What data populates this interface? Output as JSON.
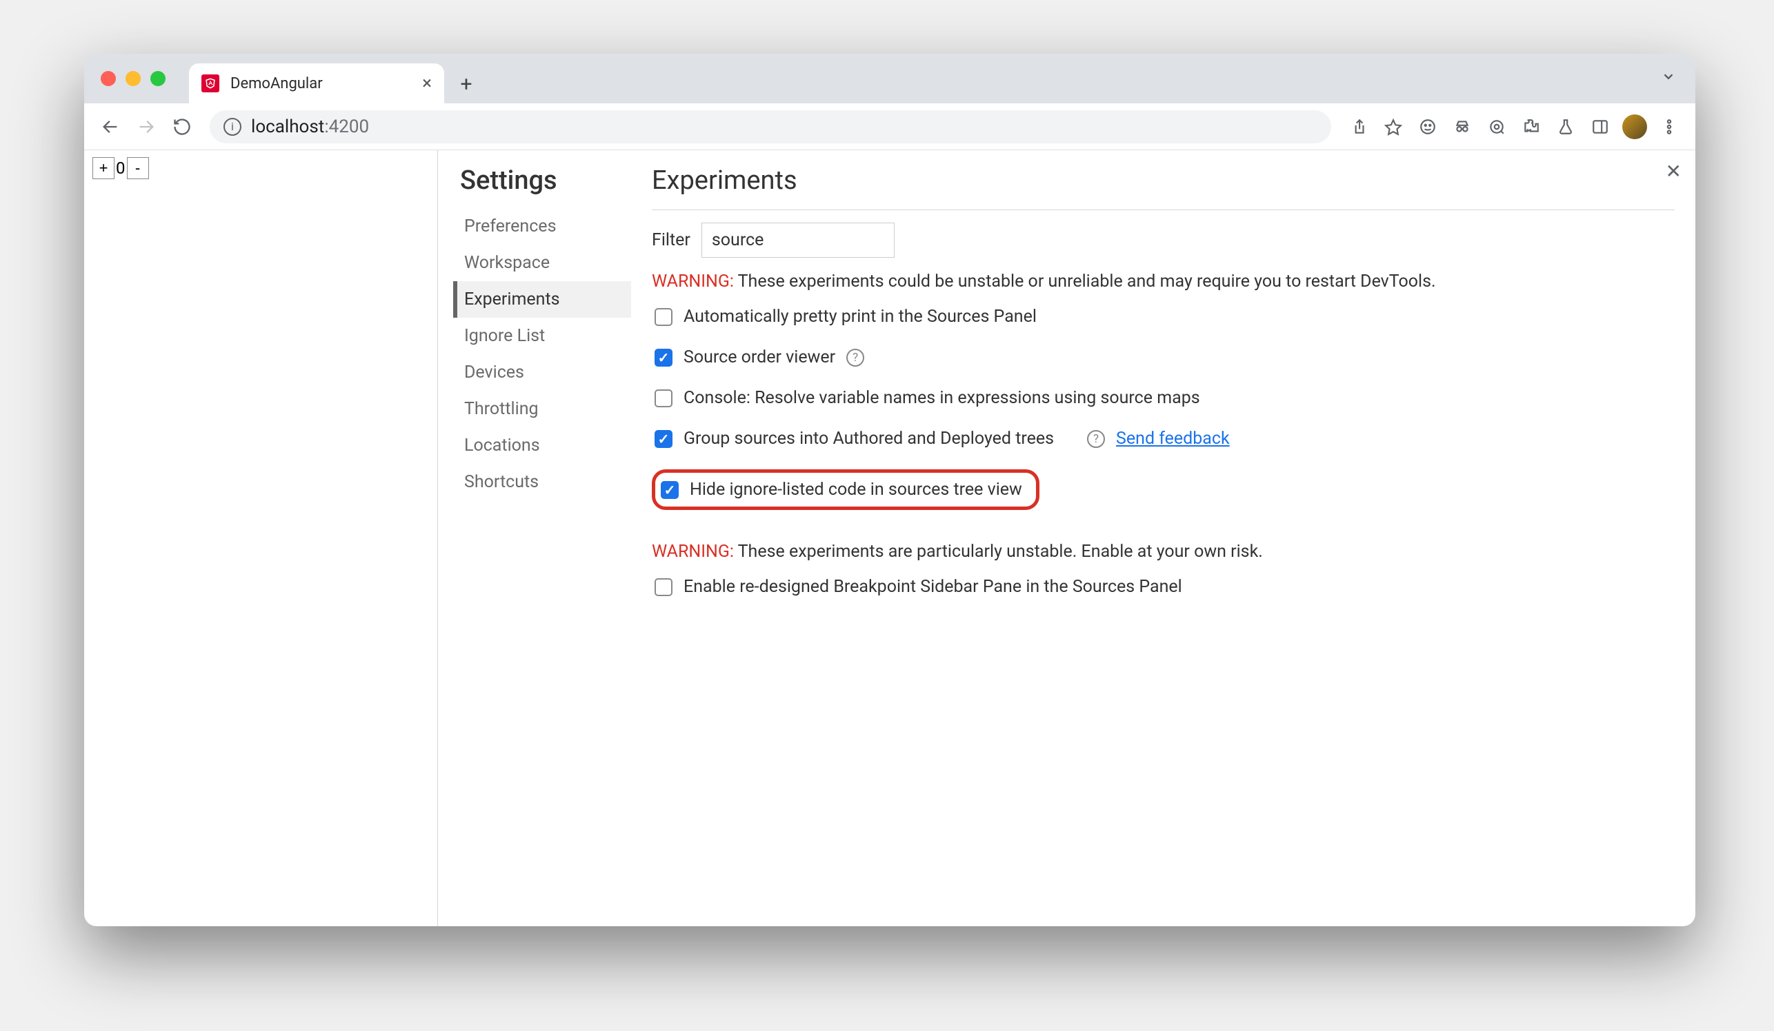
{
  "browser": {
    "tab_title": "DemoAngular",
    "url_host": "localhost",
    "url_port": ":4200"
  },
  "page": {
    "counter_value": "0"
  },
  "settings": {
    "title": "Settings",
    "sidebar": {
      "items": [
        {
          "label": "Preferences"
        },
        {
          "label": "Workspace"
        },
        {
          "label": "Experiments"
        },
        {
          "label": "Ignore List"
        },
        {
          "label": "Devices"
        },
        {
          "label": "Throttling"
        },
        {
          "label": "Locations"
        },
        {
          "label": "Shortcuts"
        }
      ],
      "active_index": 2
    },
    "panel": {
      "heading": "Experiments",
      "filter_label": "Filter",
      "filter_value": "source",
      "warning1_prefix": "WARNING:",
      "warning1_text": " These experiments could be unstable or unreliable and may require you to restart DevTools.",
      "experiments": [
        {
          "checked": false,
          "label": "Automatically pretty print in the Sources Panel",
          "help": false
        },
        {
          "checked": true,
          "label": "Source order viewer",
          "help": true
        },
        {
          "checked": false,
          "label": "Console: Resolve variable names in expressions using source maps",
          "help": false
        },
        {
          "checked": true,
          "label": "Group sources into Authored and Deployed trees",
          "help": true,
          "feedback": "Send feedback"
        },
        {
          "checked": true,
          "label": "Hide ignore-listed code in sources tree view",
          "help": false,
          "highlighted": true
        }
      ],
      "warning2_prefix": "WARNING:",
      "warning2_text": " These experiments are particularly unstable. Enable at your own risk.",
      "unstable_experiments": [
        {
          "checked": false,
          "label": "Enable re-designed Breakpoint Sidebar Pane in the Sources Panel"
        }
      ]
    }
  }
}
